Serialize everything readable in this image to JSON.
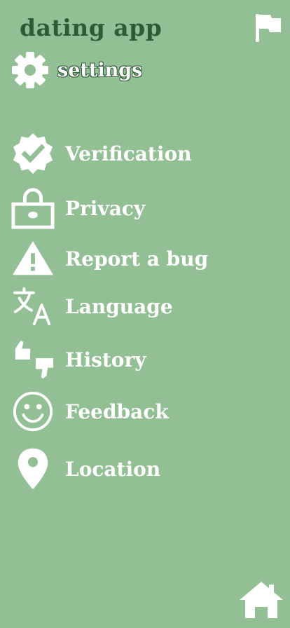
{
  "header": {
    "app_title": "dating app",
    "settings_label": "settings"
  },
  "menu": {
    "items": [
      {
        "label": "Verification",
        "icon": "verified-badge-icon"
      },
      {
        "label": "Privacy",
        "icon": "lock-icon"
      },
      {
        "label": "Report a bug",
        "icon": "warning-icon"
      },
      {
        "label": "Language",
        "icon": "translate-icon"
      },
      {
        "label": "History",
        "icon": "thumbs-up-down-icon"
      },
      {
        "label": "Feedback",
        "icon": "smiley-icon"
      },
      {
        "label": "Location",
        "icon": "location-pin-icon"
      }
    ]
  },
  "colors": {
    "background": "#92bf93",
    "title": "#2e5a35",
    "foreground": "#ffffff"
  },
  "icons": {
    "top_right": "flag-icon",
    "settings": "gear-icon",
    "bottom_right": "home-icon"
  }
}
